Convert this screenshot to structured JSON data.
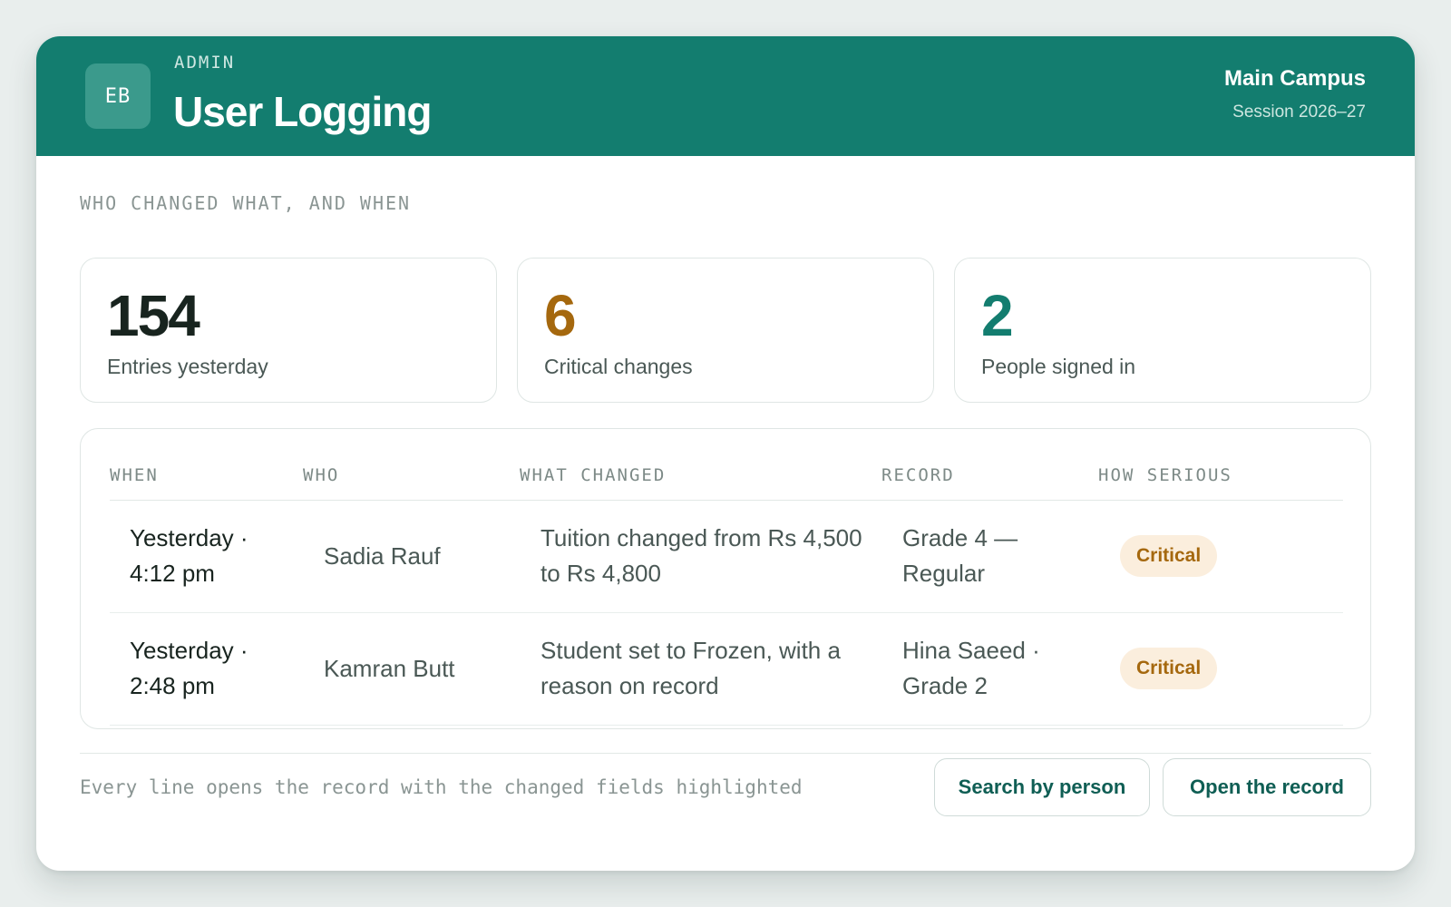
{
  "header": {
    "avatar_initials": "EB",
    "eyebrow": "ADMIN",
    "title": "User Logging",
    "campus": "Main Campus",
    "session": "Session 2026–27"
  },
  "section_label": "WHO CHANGED WHAT, AND WHEN",
  "stats": [
    {
      "value": "154",
      "label": "Entries yesterday",
      "color": "#18241f"
    },
    {
      "value": "6",
      "label": "Critical changes",
      "color": "#a5680e"
    },
    {
      "value": "2",
      "label": "People signed in",
      "color": "#137d6f"
    }
  ],
  "table": {
    "columns": [
      "WHEN",
      "WHO",
      "WHAT CHANGED",
      "RECORD",
      "HOW SERIOUS"
    ],
    "rows": [
      {
        "when": "Yesterday · 4:12 pm",
        "who": "Sadia Rauf",
        "what": "Tuition changed from Rs 4,500 to Rs 4,800",
        "record": "Grade 4 — Regular",
        "severity": "Critical"
      },
      {
        "when": "Yesterday · 2:48 pm",
        "who": "Kamran Butt",
        "what": "Student set to Frozen, with a reason on record",
        "record": "Hina Saeed · Grade 2",
        "severity": "Critical"
      }
    ]
  },
  "footer": {
    "note": "Every line opens the record with the changed fields highlighted",
    "search_button": "Search by person",
    "open_button": "Open the record"
  },
  "colors": {
    "brand": "#137d6f",
    "critical_text": "#a5680e",
    "critical_bg": "#fbeedd",
    "background": "#e9eeed"
  }
}
